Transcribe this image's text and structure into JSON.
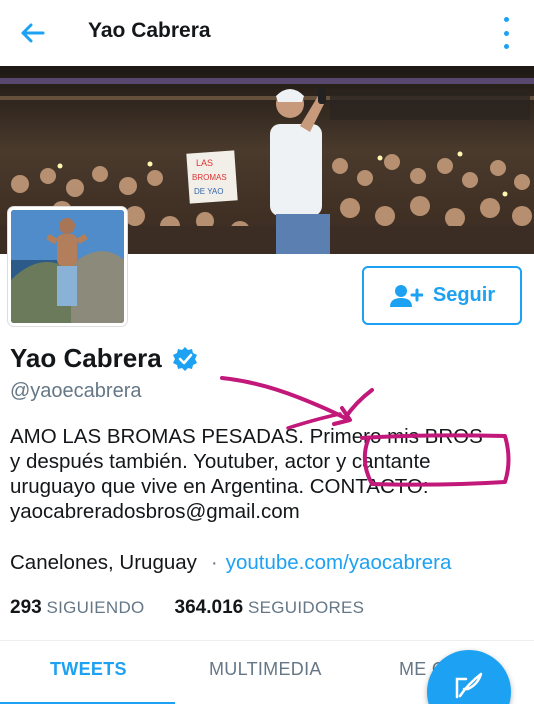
{
  "header": {
    "title": "Yao Cabrera",
    "back_icon": "arrow-left-icon",
    "more_icon": "vertical-dots-icon"
  },
  "banner": {
    "sign_text": [
      "LAS",
      "BROMAS",
      "DE YAO"
    ]
  },
  "profile": {
    "name": "Yao Cabrera",
    "handle": "@yaoecabrera",
    "verified": true,
    "bio_lines": [
      "AMO LAS BROMAS PESADAS. Primero mis BROS",
      "y después también. Youtuber, actor y cantante",
      "uruguayo que vive en Argentina. CONTACTO:",
      "yaocabreradosbros@gmail.com"
    ],
    "location": "Canelones, Uruguay",
    "separator": "·",
    "website": "youtube.com/yaocabrera"
  },
  "follow_button": {
    "label": "Seguir",
    "icon": "add-person-icon"
  },
  "stats": {
    "following_count": "293",
    "following_label": "SIGUIENDO",
    "followers_count": "364.016",
    "followers_label": "SEGUIDORES"
  },
  "tabs": [
    {
      "label": "TWEETS",
      "active": true
    },
    {
      "label": "MULTIMEDIA",
      "active": false
    },
    {
      "label": "ME G",
      "active": false
    }
  ],
  "fab": {
    "icon": "compose-feather-icon"
  },
  "colors": {
    "accent": "#1da1f2",
    "text": "#14171a",
    "muted": "#657786",
    "annotation": "#c2187a"
  }
}
